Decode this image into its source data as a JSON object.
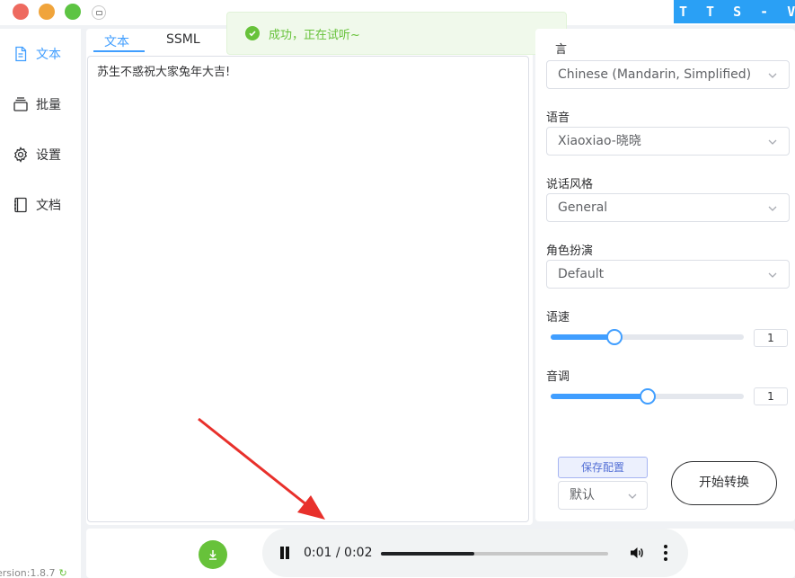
{
  "brand": {
    "title": "T T S - V U E"
  },
  "sidebar": {
    "items": [
      {
        "label": "文本",
        "icon": "document-icon",
        "active": true
      },
      {
        "label": "批量",
        "icon": "stack-icon",
        "active": false
      },
      {
        "label": "设置",
        "icon": "gear-icon",
        "active": false
      },
      {
        "label": "文档",
        "icon": "book-icon",
        "active": false
      }
    ],
    "version": "ersion:1.8.7"
  },
  "editor": {
    "tabs": [
      {
        "label": "文本",
        "active": true
      },
      {
        "label": "SSML",
        "active": false
      }
    ],
    "text": "苏生不惑祝大家兔年大吉!"
  },
  "toast": {
    "message": "成功，正在试听~",
    "type": "success"
  },
  "settings": {
    "language_label": "言",
    "language_value": "Chinese (Mandarin, Simplified)",
    "voice_label": "语音",
    "voice_value": "Xiaoxiao-晓晓",
    "style_label": "说话风格",
    "style_value": "General",
    "role_label": "角色扮演",
    "role_value": "Default",
    "rate_label": "语速",
    "rate_value": "1",
    "rate_fraction": 0.33,
    "pitch_label": "音调",
    "pitch_value": "1",
    "pitch_fraction": 0.5,
    "save_config_label": "保存配置",
    "preset_value": "默认",
    "start_label": "开始转换"
  },
  "player": {
    "time": "0:01 / 0:02",
    "progress_fraction": 0.41
  },
  "colors": {
    "accent": "#409eff",
    "success": "#67c23a",
    "brand": "#2aa0f5",
    "arrow": "#e8302b"
  }
}
